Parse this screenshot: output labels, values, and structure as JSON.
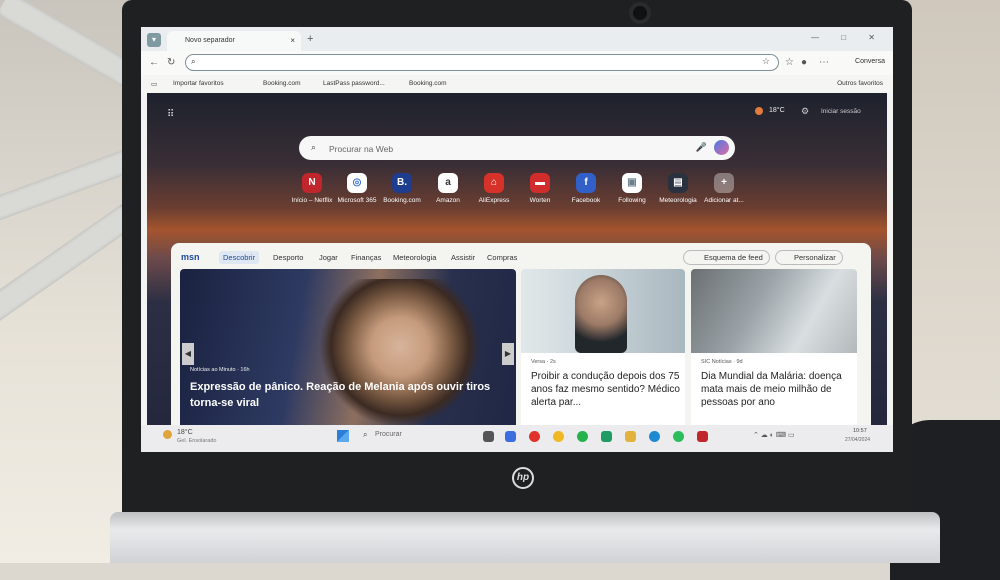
{
  "browser": {
    "tab_title": "Novo separador",
    "tab_close": "×",
    "new_tab": "+",
    "window_controls": "—  □  ✕",
    "copilot_label": "Conversa",
    "bookmarks": [
      "Importar favoritos",
      "Booking.com",
      "LastPass password...",
      "Booking.com"
    ],
    "others_label": "Outros favoritos"
  },
  "newtab": {
    "weather_temp": "18°C",
    "signin": "Iniciar sessão",
    "search_placeholder": "Procurar na Web",
    "tiles": [
      {
        "label": "Início – Netflix",
        "icon": "N"
      },
      {
        "label": "Microsoft 365",
        "icon": "◎"
      },
      {
        "label": "Booking.com",
        "icon": "B."
      },
      {
        "label": "Amazon",
        "icon": "a"
      },
      {
        "label": "AliExpress",
        "icon": "⌂"
      },
      {
        "label": "Worten",
        "icon": "▬"
      },
      {
        "label": "Facebook",
        "icon": "f"
      },
      {
        "label": "Following",
        "icon": "▣"
      },
      {
        "label": "Meteorologia",
        "icon": "▤"
      },
      {
        "label": "Adicionar at...",
        "icon": "+"
      }
    ]
  },
  "msn": {
    "logo": "msn",
    "nav": [
      "Descobrir",
      "Desporto",
      "Jogar",
      "Finanças",
      "Meteorologia",
      "Assistir",
      "Compras"
    ],
    "feed_button": "Esquema de feed",
    "personalize": "Personalizar",
    "cards": [
      {
        "source": "Notícias ao Minuto · 16h",
        "title": "Expressão de pânico. Reação de Melania após ouvir tiros torna-se viral"
      },
      {
        "source": "Versa · 2s",
        "title": "Proibir a condução depois dos 75 anos faz mesmo sentido? Médico alerta par..."
      },
      {
        "source": "SIC Notícias · 9d",
        "title": "Dia Mundial da Malária: doença mata mais de meio milhão de pessoas por ano"
      }
    ]
  },
  "taskbar": {
    "weather_temp": "18°C",
    "weather_desc": "Gel. Ensolarado",
    "search": "Procurar",
    "time": "10:57",
    "date": "27/04/2024"
  },
  "laptop": {
    "brand": "hp"
  }
}
